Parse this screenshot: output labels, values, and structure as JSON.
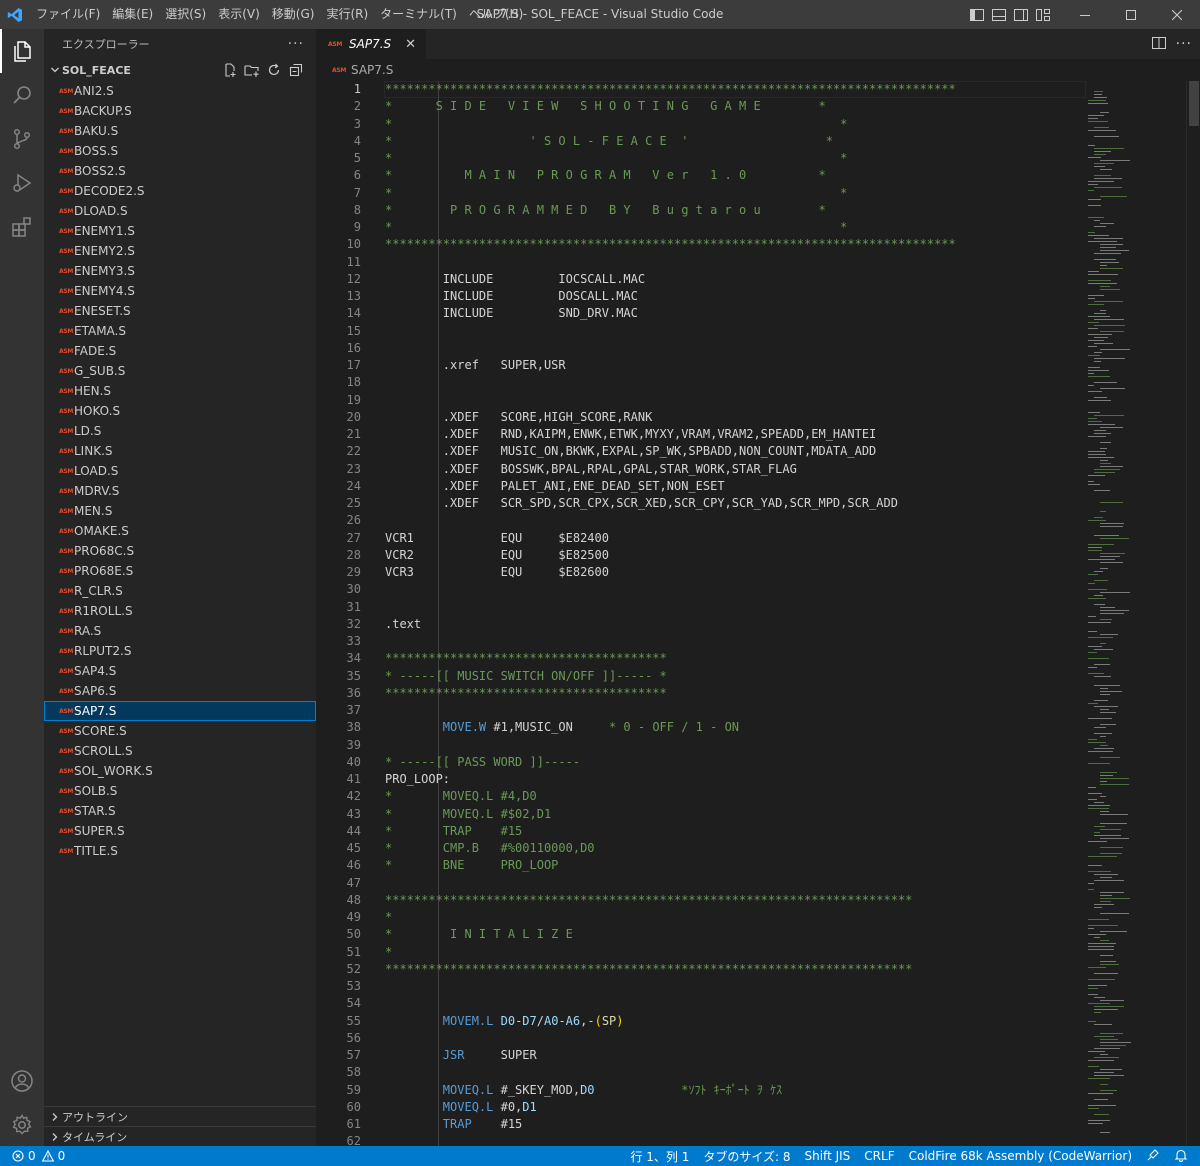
{
  "window": {
    "title": "SAP7.S - SOL_FEACE - Visual Studio Code"
  },
  "menu": [
    "ファイル(F)",
    "編集(E)",
    "選択(S)",
    "表示(V)",
    "移動(G)",
    "実行(R)",
    "ターミナル(T)",
    "ヘルプ(H)"
  ],
  "sidebar": {
    "header": "エクスプローラー",
    "more": "···",
    "folder": "SOL_FEACE",
    "file_icon": "ASM",
    "files": [
      "ANI2.S",
      "BACKUP.S",
      "BAKU.S",
      "BOSS.S",
      "BOSS2.S",
      "DECODE2.S",
      "DLOAD.S",
      "ENEMY1.S",
      "ENEMY2.S",
      "ENEMY3.S",
      "ENEMY4.S",
      "ENESET.S",
      "ETAMA.S",
      "FADE.S",
      "G_SUB.S",
      "HEN.S",
      "HOKO.S",
      "LD.S",
      "LINK.S",
      "LOAD.S",
      "MDRV.S",
      "MEN.S",
      "OMAKE.S",
      "PRO68C.S",
      "PRO68E.S",
      "R_CLR.S",
      "R1ROLL.S",
      "RA.S",
      "RLPUT2.S",
      "SAP4.S",
      "SAP6.S",
      "SAP7.S",
      "SCORE.S",
      "SCROLL.S",
      "SOL_WORK.S",
      "SOLB.S",
      "STAR.S",
      "SUPER.S",
      "TITLE.S"
    ],
    "selected": "SAP7.S",
    "outline": "アウトライン",
    "timeline": "タイムライン"
  },
  "editor": {
    "tab": {
      "label": "SAP7.S",
      "close": "✕"
    },
    "breadcrumb": "SAP7.S",
    "current_line": 1,
    "lines": [
      [
        [
          "c-com",
          "*******************************************************************************"
        ]
      ],
      [
        [
          "c-com",
          "*      S I D E   V I E W   S H O O T I N G   G A M E        *"
        ]
      ],
      [
        [
          "c-com",
          "*                                                              *"
        ]
      ],
      [
        [
          "c-com",
          "*                   ' S O L - F E A C E  '                   *"
        ]
      ],
      [
        [
          "c-com",
          "*                                                              *"
        ]
      ],
      [
        [
          "c-com",
          "*          M A I N   P R O G R A M   V e r   1 . 0          *"
        ]
      ],
      [
        [
          "c-com",
          "*                                                              *"
        ]
      ],
      [
        [
          "c-com",
          "*        P R O G R A M M E D   B Y   B u g t a r o u        *"
        ]
      ],
      [
        [
          "c-com",
          "*                                                              *"
        ]
      ],
      [
        [
          "c-com",
          "*******************************************************************************"
        ]
      ],
      [],
      [
        [
          "",
          "        INCLUDE         IOCSCALL.MAC"
        ]
      ],
      [
        [
          "",
          "        INCLUDE         DOSCALL.MAC"
        ]
      ],
      [
        [
          "",
          "        INCLUDE         SND_DRV.MAC"
        ]
      ],
      [],
      [],
      [
        [
          "",
          "        .xref   SUPER,USR"
        ]
      ],
      [],
      [],
      [
        [
          "",
          "        .XDEF   SCORE,HIGH_SCORE,RANK"
        ]
      ],
      [
        [
          "",
          "        .XDEF   RND,KAIPM,ENWK,ETWK,MYXY,VRAM,VRAM2,SPEADD,EM_HANTEI"
        ]
      ],
      [
        [
          "",
          "        .XDEF   MUSIC_ON,BKWK,EXPAL,SP_WK,SPBADD,NON_COUNT,MDATA_ADD"
        ]
      ],
      [
        [
          "",
          "        .XDEF   BOSSWK,BPAL,RPAL,GPAL,STAR_WORK,STAR_FLAG"
        ]
      ],
      [
        [
          "",
          "        .XDEF   PALET_ANI,ENE_DEAD_SET,NON_ESET"
        ]
      ],
      [
        [
          "",
          "        .XDEF   SCR_SPD,SCR_CPX,SCR_XED,SCR_CPY,SCR_YAD,SCR_MPD,SCR_ADD"
        ]
      ],
      [],
      [
        [
          "",
          "VCR1            EQU     $E82400"
        ]
      ],
      [
        [
          "",
          "VCR2            EQU     $E82500"
        ]
      ],
      [
        [
          "",
          "VCR3            EQU     $E82600"
        ]
      ],
      [],
      [],
      [
        [
          "",
          ".text"
        ]
      ],
      [],
      [
        [
          "c-com",
          "***************************************"
        ]
      ],
      [
        [
          "c-com",
          "* -----[[ MUSIC SWITCH ON/OFF ]]----- *"
        ]
      ],
      [
        [
          "c-com",
          "***************************************"
        ]
      ],
      [],
      [
        [
          "",
          "        "
        ],
        [
          "c-kw",
          "MOVE.W"
        ],
        [
          "",
          " #1,MUSIC_ON     "
        ],
        [
          "c-com",
          "* 0 - OFF / 1 - ON"
        ]
      ],
      [],
      [
        [
          "c-com",
          "* -----[[ PASS WORD ]]-----"
        ]
      ],
      [
        [
          "",
          "PRO_LOOP:"
        ]
      ],
      [
        [
          "c-com",
          "*       MOVEQ.L #4,D0"
        ]
      ],
      [
        [
          "c-com",
          "*       MOVEQ.L #$02,D1"
        ]
      ],
      [
        [
          "c-com",
          "*       TRAP    #15"
        ]
      ],
      [
        [
          "c-com",
          "*       CMP.B   #%00110000,D0"
        ]
      ],
      [
        [
          "c-com",
          "*       BNE     PRO_LOOP"
        ]
      ],
      [],
      [
        [
          "c-com",
          "*************************************************************************"
        ]
      ],
      [
        [
          "c-com",
          "*"
        ]
      ],
      [
        [
          "c-com",
          "*        I N I T A L I Z E"
        ]
      ],
      [
        [
          "c-com",
          "*"
        ]
      ],
      [
        [
          "c-com",
          "*************************************************************************"
        ]
      ],
      [],
      [],
      [
        [
          "",
          "        "
        ],
        [
          "c-kw",
          "MOVEM.L"
        ],
        [
          "",
          " "
        ],
        [
          "c-reg",
          "D0"
        ],
        [
          "",
          "-"
        ],
        [
          "c-reg",
          "D7"
        ],
        [
          "",
          "/"
        ],
        [
          "c-reg",
          "A0"
        ],
        [
          "",
          "-"
        ],
        [
          "c-reg",
          "A6"
        ],
        [
          "",
          ",-"
        ],
        [
          "c-paren",
          "("
        ],
        [
          "c-sp",
          "SP"
        ],
        [
          "c-paren",
          ")"
        ]
      ],
      [],
      [
        [
          "",
          "        "
        ],
        [
          "c-kw",
          "JSR"
        ],
        [
          "",
          "     SUPER"
        ]
      ],
      [],
      [
        [
          "",
          "        "
        ],
        [
          "c-kw",
          "MOVEQ.L"
        ],
        [
          "",
          " #_SKEY_MOD,"
        ],
        [
          "c-reg",
          "D0"
        ],
        [
          "",
          "            "
        ],
        [
          "c-com",
          "*ｿﾌﾄ ｷｰﾎﾟｰﾄ ｦ ｹｽ"
        ]
      ],
      [
        [
          "",
          "        "
        ],
        [
          "c-kw",
          "MOVEQ.L"
        ],
        [
          "",
          " #0,"
        ],
        [
          "c-reg",
          "D1"
        ]
      ],
      [
        [
          "",
          "        "
        ],
        [
          "c-kw",
          "TRAP"
        ],
        [
          "",
          "    #15"
        ]
      ],
      []
    ]
  },
  "status": {
    "errors": "0",
    "warnings": "0",
    "position": "行 1、列 1",
    "tabsize": "タブのサイズ: 8",
    "encoding": "Shift JIS",
    "eol": "CRLF",
    "language": "ColdFire 68k Assembly (CodeWarrior)"
  },
  "colors": {
    "accent": "#007acc",
    "comment": "#6a9955",
    "keyword": "#569cd6",
    "asm_icon": "#e34c26"
  }
}
